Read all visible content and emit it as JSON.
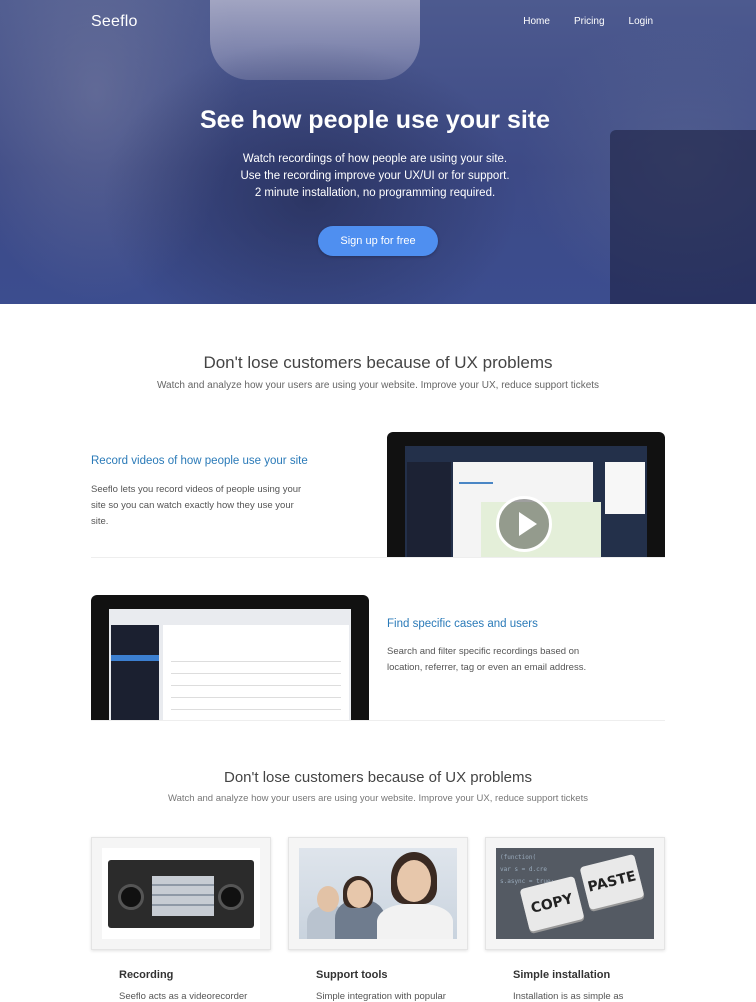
{
  "nav": {
    "brand": "Seeflo",
    "links": [
      "Home",
      "Pricing",
      "Login"
    ]
  },
  "hero": {
    "title": "See how people use your site",
    "subtitle_lines": [
      "Watch recordings of how people are using your site.",
      "Use the recording improve your UX/UI or for support.",
      "2 minute installation, no programming required."
    ],
    "cta": "Sign up for free"
  },
  "section1": {
    "title": "Don't lose customers because of UX problems",
    "subtitle": "Watch and analyze how your users are using your website. Improve your UX, reduce support tickets",
    "features": [
      {
        "title": "Record videos of how people use your site",
        "text_lines": [
          "Seeflo lets you record videos of people using your",
          "site so you can watch exactly how they use your",
          "site."
        ]
      },
      {
        "title": "Find specific cases and users",
        "text_lines": [
          "Search and filter specific recordings based on",
          "location, referrer, tag or even an email address."
        ]
      }
    ]
  },
  "section2": {
    "title": "Don't lose customers because of UX problems",
    "subtitle": "Watch and analyze how your users are using your website. Improve your UX, reduce support tickets",
    "cards": [
      {
        "title": "Recording",
        "text": "Seeflo acts as a videorecorder"
      },
      {
        "title": "Support tools",
        "text": "Simple integration with popular"
      },
      {
        "title": "Simple installation",
        "text": "Installation is as simple as"
      }
    ],
    "keyboard_keys": [
      "COPY",
      "PASTE"
    ]
  },
  "colors": {
    "hero_bg": "#3d4a86",
    "cta": "#4f8ff0",
    "link": "#2a7ab8"
  }
}
